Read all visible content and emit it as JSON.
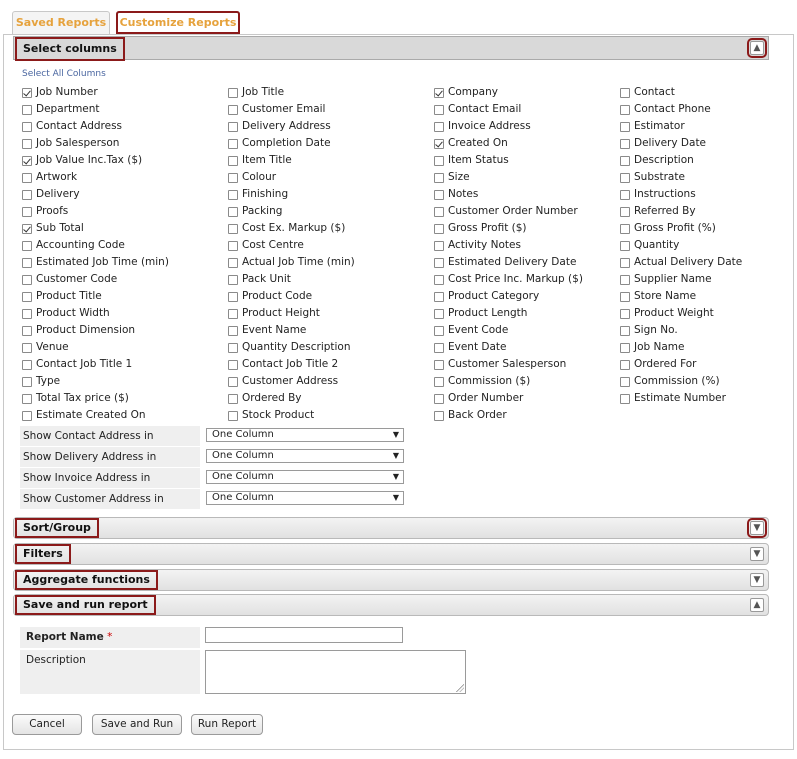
{
  "tabs": [
    {
      "label": "Saved Reports"
    },
    {
      "label": "Customize Reports"
    }
  ],
  "sections": {
    "select_columns": "Select columns",
    "sort_group": "Sort/Group",
    "filters": "Filters",
    "aggregate": "Aggregate functions",
    "save_run": "Save and run report"
  },
  "select_all": "Select All Columns",
  "columns": [
    [
      {
        "label": "Job Number",
        "checked": true
      },
      {
        "label": "Department",
        "checked": false
      },
      {
        "label": "Contact Address",
        "checked": false
      },
      {
        "label": "Job Salesperson",
        "checked": false
      },
      {
        "label": "Job Value Inc.Tax ($)",
        "checked": true
      },
      {
        "label": "Artwork",
        "checked": false
      },
      {
        "label": "Delivery",
        "checked": false
      },
      {
        "label": "Proofs",
        "checked": false
      },
      {
        "label": "Sub Total",
        "checked": true
      },
      {
        "label": "Accounting Code",
        "checked": false
      },
      {
        "label": "Estimated Job Time (min)",
        "checked": false
      },
      {
        "label": "Customer Code",
        "checked": false
      },
      {
        "label": "Product Title",
        "checked": false
      },
      {
        "label": "Product Width",
        "checked": false
      },
      {
        "label": "Product Dimension",
        "checked": false
      },
      {
        "label": "Venue",
        "checked": false
      },
      {
        "label": "Contact Job Title 1",
        "checked": false
      },
      {
        "label": "Type",
        "checked": false
      },
      {
        "label": "Total Tax price ($)",
        "checked": false
      },
      {
        "label": "Estimate Created On",
        "checked": false
      }
    ],
    [
      {
        "label": "Job Title",
        "checked": false
      },
      {
        "label": "Customer Email",
        "checked": false
      },
      {
        "label": "Delivery Address",
        "checked": false
      },
      {
        "label": "Completion Date",
        "checked": false
      },
      {
        "label": "Item Title",
        "checked": false
      },
      {
        "label": "Colour",
        "checked": false
      },
      {
        "label": "Finishing",
        "checked": false
      },
      {
        "label": "Packing",
        "checked": false
      },
      {
        "label": "Cost Ex. Markup ($)",
        "checked": false
      },
      {
        "label": "Cost Centre",
        "checked": false
      },
      {
        "label": "Actual Job Time (min)",
        "checked": false
      },
      {
        "label": "Pack Unit",
        "checked": false
      },
      {
        "label": "Product Code",
        "checked": false
      },
      {
        "label": "Product Height",
        "checked": false
      },
      {
        "label": "Event Name",
        "checked": false
      },
      {
        "label": "Quantity Description",
        "checked": false
      },
      {
        "label": "Contact Job Title 2",
        "checked": false
      },
      {
        "label": "Customer Address",
        "checked": false
      },
      {
        "label": "Ordered By",
        "checked": false
      },
      {
        "label": "Stock Product",
        "checked": false
      }
    ],
    [
      {
        "label": "Company",
        "checked": true
      },
      {
        "label": "Contact Email",
        "checked": false
      },
      {
        "label": "Invoice Address",
        "checked": false
      },
      {
        "label": "Created On",
        "checked": true
      },
      {
        "label": "Item Status",
        "checked": false
      },
      {
        "label": "Size",
        "checked": false
      },
      {
        "label": "Notes",
        "checked": false
      },
      {
        "label": "Customer Order Number",
        "checked": false
      },
      {
        "label": "Gross Profit ($)",
        "checked": false
      },
      {
        "label": "Activity Notes",
        "checked": false
      },
      {
        "label": "Estimated Delivery Date",
        "checked": false
      },
      {
        "label": "Cost Price Inc. Markup ($)",
        "checked": false
      },
      {
        "label": "Product Category",
        "checked": false
      },
      {
        "label": "Product Length",
        "checked": false
      },
      {
        "label": "Event Code",
        "checked": false
      },
      {
        "label": "Event Date",
        "checked": false
      },
      {
        "label": "Customer Salesperson",
        "checked": false
      },
      {
        "label": "Commission ($)",
        "checked": false
      },
      {
        "label": "Order Number",
        "checked": false
      },
      {
        "label": "Back Order",
        "checked": false
      }
    ],
    [
      {
        "label": "Contact",
        "checked": false
      },
      {
        "label": "Contact Phone",
        "checked": false
      },
      {
        "label": "Estimator",
        "checked": false
      },
      {
        "label": "Delivery Date",
        "checked": false
      },
      {
        "label": "Description",
        "checked": false
      },
      {
        "label": "Substrate",
        "checked": false
      },
      {
        "label": "Instructions",
        "checked": false
      },
      {
        "label": "Referred By",
        "checked": false
      },
      {
        "label": "Gross Profit (%)",
        "checked": false
      },
      {
        "label": "Quantity",
        "checked": false
      },
      {
        "label": "Actual Delivery Date",
        "checked": false
      },
      {
        "label": "Supplier Name",
        "checked": false
      },
      {
        "label": "Store Name",
        "checked": false
      },
      {
        "label": "Product Weight",
        "checked": false
      },
      {
        "label": "Sign No.",
        "checked": false
      },
      {
        "label": "Job Name",
        "checked": false
      },
      {
        "label": "Ordered For",
        "checked": false
      },
      {
        "label": "Commission (%)",
        "checked": false
      },
      {
        "label": "Estimate Number",
        "checked": false
      }
    ]
  ],
  "address_options": [
    {
      "label": "Show Contact Address in",
      "value": "One Column"
    },
    {
      "label": "Show Delivery Address in",
      "value": "One Column"
    },
    {
      "label": "Show Invoice Address in",
      "value": "One Column"
    },
    {
      "label": "Show Customer Address in",
      "value": "One Column"
    }
  ],
  "form": {
    "report_name_label": "Report Name",
    "required_mark": "*",
    "report_name_value": "",
    "description_label": "Description",
    "description_value": ""
  },
  "buttons": {
    "cancel": "Cancel",
    "save_run": "Save and Run",
    "run": "Run Report"
  },
  "icons": {
    "collapse": "▲",
    "expand": "▼"
  }
}
